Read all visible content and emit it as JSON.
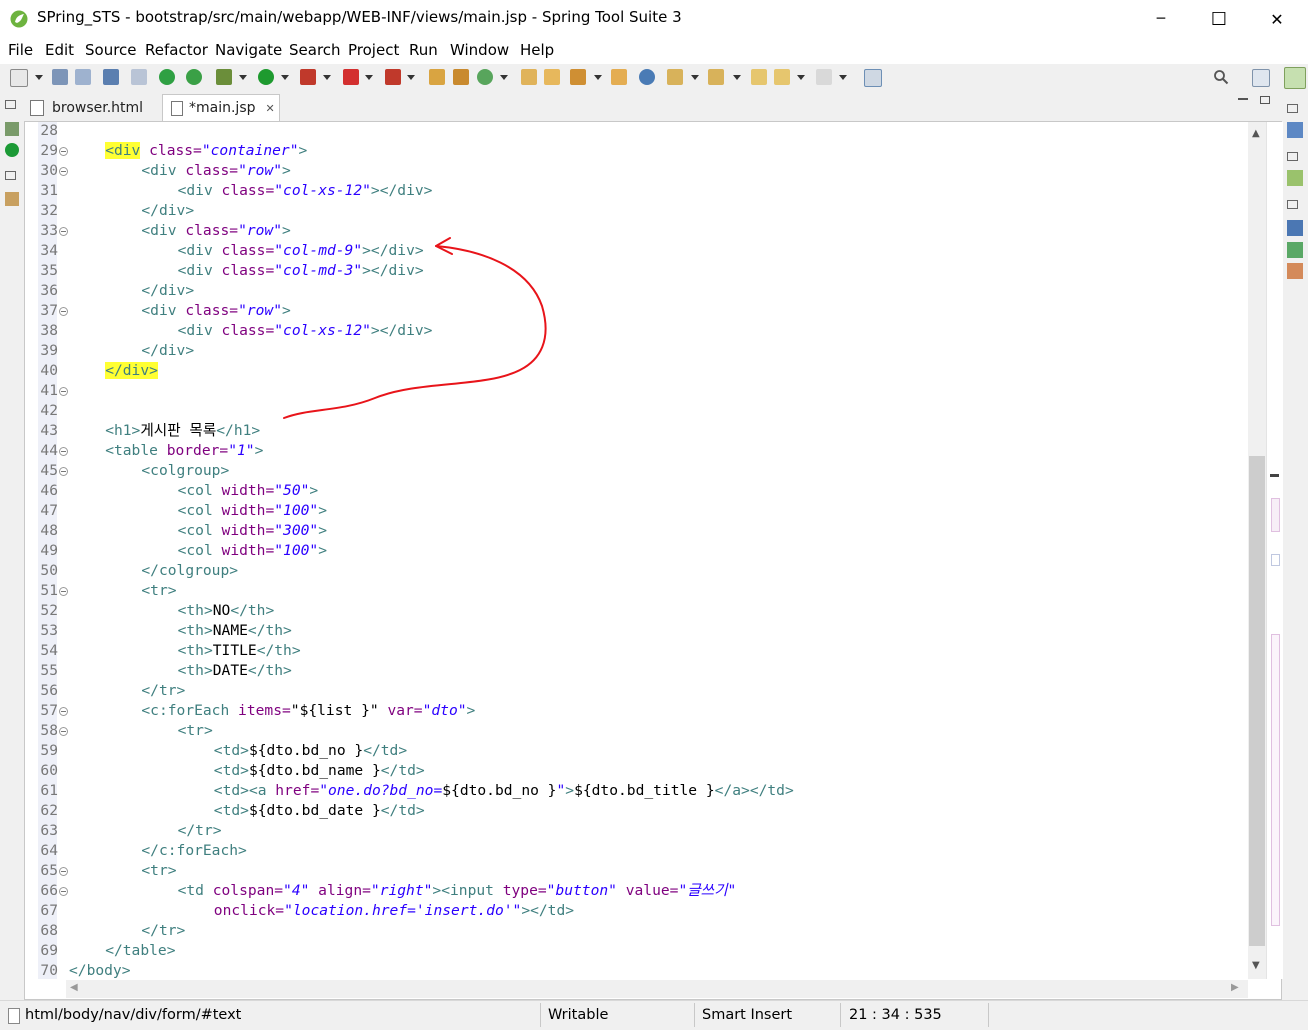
{
  "window": {
    "title": "SPring_STS - bootstrap/src/main/webapp/WEB-INF/views/main.jsp - Spring Tool Suite 3",
    "minimize": "─",
    "maximize": "☐",
    "close": "✕"
  },
  "menu": [
    "File",
    "Edit",
    "Source",
    "Refactor",
    "Navigate",
    "Search",
    "Project",
    "Run",
    "Window",
    "Help"
  ],
  "editor": {
    "tabs": [
      {
        "label": "browser.html",
        "active": false,
        "icon": "html-file-icon"
      },
      {
        "label": "*main.jsp",
        "active": true,
        "icon": "jsp-file-icon",
        "close": "✕"
      }
    ]
  },
  "code": [
    {
      "n": "28",
      "fold": false,
      "indent": 0,
      "s": []
    },
    {
      "n": "29",
      "fold": true,
      "indent": 2,
      "s": [
        [
          "t",
          "<div",
          1
        ],
        [
          "a",
          " class="
        ],
        [
          "v",
          "\"container\""
        ],
        [
          "t",
          ">"
        ]
      ]
    },
    {
      "n": "30",
      "fold": true,
      "indent": 4,
      "s": [
        [
          "t",
          "<div"
        ],
        [
          "a",
          " class="
        ],
        [
          "v",
          "\"row\""
        ],
        [
          "t",
          ">"
        ]
      ]
    },
    {
      "n": "31",
      "fold": false,
      "indent": 6,
      "s": [
        [
          "t",
          "<div"
        ],
        [
          "a",
          " class="
        ],
        [
          "v",
          "\"col-xs-12\""
        ],
        [
          "t",
          "></div>"
        ]
      ]
    },
    {
      "n": "32",
      "fold": false,
      "indent": 4,
      "s": [
        [
          "t",
          "</div>"
        ]
      ]
    },
    {
      "n": "33",
      "fold": true,
      "indent": 4,
      "s": [
        [
          "t",
          "<div"
        ],
        [
          "a",
          " class="
        ],
        [
          "v",
          "\"row\""
        ],
        [
          "t",
          ">"
        ]
      ]
    },
    {
      "n": "34",
      "fold": false,
      "indent": 6,
      "s": [
        [
          "t",
          "<div"
        ],
        [
          "a",
          " class="
        ],
        [
          "v",
          "\"col-md-9\""
        ],
        [
          "t",
          "></div>"
        ]
      ]
    },
    {
      "n": "35",
      "fold": false,
      "indent": 6,
      "s": [
        [
          "t",
          "<div"
        ],
        [
          "a",
          " class="
        ],
        [
          "v",
          "\"col-md-3\""
        ],
        [
          "t",
          "></div>"
        ]
      ]
    },
    {
      "n": "36",
      "fold": false,
      "indent": 4,
      "s": [
        [
          "t",
          "</div>"
        ]
      ]
    },
    {
      "n": "37",
      "fold": true,
      "indent": 4,
      "s": [
        [
          "t",
          "<div"
        ],
        [
          "a",
          " class="
        ],
        [
          "v",
          "\"row\""
        ],
        [
          "t",
          ">"
        ]
      ]
    },
    {
      "n": "38",
      "fold": false,
      "indent": 6,
      "s": [
        [
          "t",
          "<div"
        ],
        [
          "a",
          " class="
        ],
        [
          "v",
          "\"col-xs-12\""
        ],
        [
          "t",
          "></div>"
        ]
      ]
    },
    {
      "n": "39",
      "fold": false,
      "indent": 4,
      "s": [
        [
          "t",
          "</div>"
        ]
      ]
    },
    {
      "n": "40",
      "fold": false,
      "indent": 2,
      "s": [
        [
          "t",
          "</div>",
          1
        ]
      ]
    },
    {
      "n": "41",
      "fold": true,
      "indent": 0,
      "s": []
    },
    {
      "n": "42",
      "fold": false,
      "indent": 0,
      "s": []
    },
    {
      "n": "43",
      "fold": false,
      "indent": 2,
      "s": [
        [
          "t",
          "<h1>"
        ],
        [
          "x",
          "게시판 목록"
        ],
        [
          "t",
          "</h1>"
        ]
      ]
    },
    {
      "n": "44",
      "fold": true,
      "indent": 2,
      "s": [
        [
          "t",
          "<table"
        ],
        [
          "a",
          " border="
        ],
        [
          "v",
          "\"1\""
        ],
        [
          "t",
          ">"
        ]
      ]
    },
    {
      "n": "45",
      "fold": true,
      "indent": 4,
      "s": [
        [
          "t",
          "<colgroup>"
        ]
      ]
    },
    {
      "n": "46",
      "fold": false,
      "indent": 6,
      "s": [
        [
          "t",
          "<col"
        ],
        [
          "a",
          " width="
        ],
        [
          "v",
          "\"50\""
        ],
        [
          "t",
          ">"
        ]
      ]
    },
    {
      "n": "47",
      "fold": false,
      "indent": 6,
      "s": [
        [
          "t",
          "<col"
        ],
        [
          "a",
          " width="
        ],
        [
          "v",
          "\"100\""
        ],
        [
          "t",
          ">"
        ]
      ]
    },
    {
      "n": "48",
      "fold": false,
      "indent": 6,
      "s": [
        [
          "t",
          "<col"
        ],
        [
          "a",
          " width="
        ],
        [
          "v",
          "\"300\""
        ],
        [
          "t",
          ">"
        ]
      ]
    },
    {
      "n": "49",
      "fold": false,
      "indent": 6,
      "s": [
        [
          "t",
          "<col"
        ],
        [
          "a",
          " width="
        ],
        [
          "v",
          "\"100\""
        ],
        [
          "t",
          ">"
        ]
      ]
    },
    {
      "n": "50",
      "fold": false,
      "indent": 4,
      "s": [
        [
          "t",
          "</colgroup>"
        ]
      ]
    },
    {
      "n": "51",
      "fold": true,
      "indent": 4,
      "s": [
        [
          "t",
          "<tr>"
        ]
      ]
    },
    {
      "n": "52",
      "fold": false,
      "indent": 6,
      "s": [
        [
          "t",
          "<th>"
        ],
        [
          "x",
          "NO"
        ],
        [
          "t",
          "</th>"
        ]
      ]
    },
    {
      "n": "53",
      "fold": false,
      "indent": 6,
      "s": [
        [
          "t",
          "<th>"
        ],
        [
          "x",
          "NAME"
        ],
        [
          "t",
          "</th>"
        ]
      ]
    },
    {
      "n": "54",
      "fold": false,
      "indent": 6,
      "s": [
        [
          "t",
          "<th>"
        ],
        [
          "x",
          "TITLE"
        ],
        [
          "t",
          "</th>"
        ]
      ]
    },
    {
      "n": "55",
      "fold": false,
      "indent": 6,
      "s": [
        [
          "t",
          "<th>"
        ],
        [
          "x",
          "DATE"
        ],
        [
          "t",
          "</th>"
        ]
      ]
    },
    {
      "n": "56",
      "fold": false,
      "indent": 4,
      "s": [
        [
          "t",
          "</tr>"
        ]
      ]
    },
    {
      "n": "57",
      "fold": true,
      "indent": 4,
      "s": [
        [
          "t",
          "<c:forEach"
        ],
        [
          "a",
          " items="
        ],
        [
          "e",
          "\"${list }\""
        ],
        [
          "a",
          " var="
        ],
        [
          "v",
          "\"dto\""
        ],
        [
          "t",
          ">"
        ]
      ]
    },
    {
      "n": "58",
      "fold": true,
      "indent": 6,
      "s": [
        [
          "t",
          "<tr>"
        ]
      ]
    },
    {
      "n": "59",
      "fold": false,
      "indent": 8,
      "s": [
        [
          "t",
          "<td>"
        ],
        [
          "e",
          "${dto.bd_no }"
        ],
        [
          "t",
          "</td>"
        ]
      ]
    },
    {
      "n": "60",
      "fold": false,
      "indent": 8,
      "s": [
        [
          "t",
          "<td>"
        ],
        [
          "e",
          "${dto.bd_name }"
        ],
        [
          "t",
          "</td>"
        ]
      ]
    },
    {
      "n": "61",
      "fold": false,
      "indent": 8,
      "s": [
        [
          "t",
          "<td><a"
        ],
        [
          "a",
          " href="
        ],
        [
          "v",
          "\"one.do?bd_no="
        ],
        [
          "e",
          "${dto.bd_no }"
        ],
        [
          "v",
          "\""
        ],
        [
          "t",
          ">"
        ],
        [
          "e",
          "${dto.bd_title }"
        ],
        [
          "t",
          "</a></td>"
        ]
      ]
    },
    {
      "n": "62",
      "fold": false,
      "indent": 8,
      "s": [
        [
          "t",
          "<td>"
        ],
        [
          "e",
          "${dto.bd_date }"
        ],
        [
          "t",
          "</td>"
        ]
      ]
    },
    {
      "n": "63",
      "fold": false,
      "indent": 6,
      "s": [
        [
          "t",
          "</tr>"
        ]
      ]
    },
    {
      "n": "64",
      "fold": false,
      "indent": 4,
      "s": [
        [
          "t",
          "</c:forEach>"
        ]
      ]
    },
    {
      "n": "65",
      "fold": true,
      "indent": 4,
      "s": [
        [
          "t",
          "<tr>"
        ]
      ]
    },
    {
      "n": "66",
      "fold": true,
      "indent": 6,
      "s": [
        [
          "t",
          "<td"
        ],
        [
          "a",
          " colspan="
        ],
        [
          "v",
          "\"4\""
        ],
        [
          "a",
          " align="
        ],
        [
          "v",
          "\"right\""
        ],
        [
          "t",
          "><input"
        ],
        [
          "a",
          " type="
        ],
        [
          "v",
          "\"button\""
        ],
        [
          "a",
          " value="
        ],
        [
          "v",
          "\"글쓰기\""
        ]
      ]
    },
    {
      "n": "67",
      "fold": false,
      "indent": 8,
      "s": [
        [
          "a",
          "onclick="
        ],
        [
          "v",
          "\"location.href='insert.do'\""
        ],
        [
          "t",
          "></td>"
        ]
      ]
    },
    {
      "n": "68",
      "fold": false,
      "indent": 4,
      "s": [
        [
          "t",
          "</tr>"
        ]
      ]
    },
    {
      "n": "69",
      "fold": false,
      "indent": 2,
      "s": [
        [
          "t",
          "</table>"
        ]
      ]
    },
    {
      "n": "70",
      "fold": false,
      "indent": 0,
      "s": [
        [
          "t",
          "</body>"
        ]
      ]
    }
  ],
  "status": {
    "path": "html/body/nav/div/form/#text",
    "mode": "Writable",
    "insert": "Smart Insert",
    "position": "21 : 34 : 535"
  },
  "colors": {
    "tag": "#3f7f7f",
    "attribute": "#7f007f",
    "value": "#2a00ff",
    "highlight": "#ffff33",
    "annotation": "#e8141a"
  }
}
